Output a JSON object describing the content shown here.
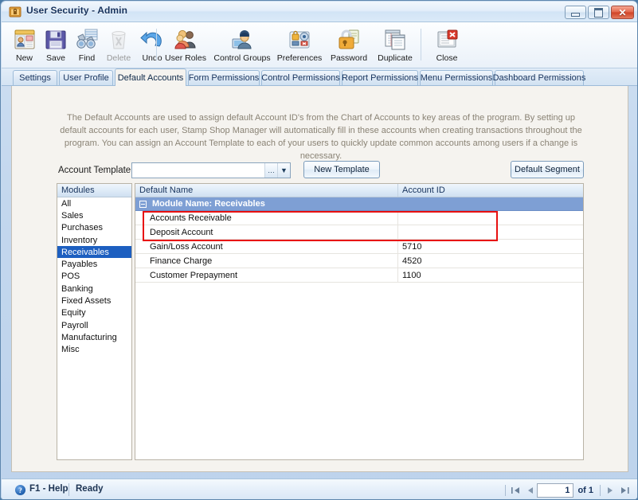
{
  "window": {
    "title": "User Security - Admin",
    "icon": "security-shield-icon",
    "minimize_label": "–",
    "maximize_label": "□",
    "close_label": "✕"
  },
  "toolbar": {
    "buttons": [
      {
        "label": "New",
        "icon": "new-record-icon",
        "enabled": true
      },
      {
        "label": "Save",
        "icon": "floppy-disk-icon",
        "enabled": true
      },
      {
        "label": "Find",
        "icon": "binoculars-icon",
        "enabled": true
      },
      {
        "label": "Delete",
        "icon": "recycle-bin-icon",
        "enabled": false
      },
      {
        "label": "Undo",
        "icon": "undo-arrow-icon",
        "enabled": true
      },
      {
        "label": "User Roles",
        "icon": "users-group-icon",
        "enabled": true
      },
      {
        "label": "Control Groups",
        "icon": "user-monitor-icon",
        "enabled": true
      },
      {
        "label": "Preferences",
        "icon": "lock-settings-icon",
        "enabled": true
      },
      {
        "label": "Password",
        "icon": "padlock-key-icon",
        "enabled": true
      },
      {
        "label": "Duplicate",
        "icon": "copy-window-icon",
        "enabled": true
      },
      {
        "label": "Close",
        "icon": "close-window-icon",
        "enabled": true
      }
    ]
  },
  "tabs": [
    {
      "label": "Settings",
      "active": false
    },
    {
      "label": "User Profile",
      "active": false
    },
    {
      "label": "Default Accounts",
      "active": true
    },
    {
      "label": "Form Permissions",
      "active": false
    },
    {
      "label": "Control Permissions",
      "active": false
    },
    {
      "label": "Report Permissions",
      "active": false
    },
    {
      "label": "Menu Permissions",
      "active": false
    },
    {
      "label": "Dashboard Permissions",
      "active": false
    }
  ],
  "content": {
    "description": "The Default Accounts are used to assign default Account ID's from the Chart of Accounts to key areas of the program.  By setting up default accounts for each user, Stamp Shop Manager will automatically fill in these accounts when creating transactions throughout the program.  You can assign an Account Template to each of your users to quickly update common accounts among users if a change is necessary.",
    "account_template_label": "Account Template",
    "account_template_value": "",
    "account_template_placeholder": "",
    "ellipsis_button": "…",
    "dropdown_button": "▼",
    "new_template_button": "New Template",
    "default_segment_button": "Default Segment"
  },
  "modules": {
    "header": "Modules",
    "items": [
      {
        "label": "All",
        "selected": false
      },
      {
        "label": "Sales",
        "selected": false
      },
      {
        "label": "Purchases",
        "selected": false
      },
      {
        "label": "Inventory",
        "selected": false
      },
      {
        "label": "Receivables",
        "selected": true
      },
      {
        "label": "Payables",
        "selected": false
      },
      {
        "label": "POS",
        "selected": false
      },
      {
        "label": "Banking",
        "selected": false
      },
      {
        "label": "Fixed Assets",
        "selected": false
      },
      {
        "label": "Equity",
        "selected": false
      },
      {
        "label": "Payroll",
        "selected": false
      },
      {
        "label": "Manufacturing",
        "selected": false
      },
      {
        "label": "Misc",
        "selected": false
      }
    ]
  },
  "grid": {
    "columns": [
      "Default Name",
      "Account ID"
    ],
    "group_row": "Module Name: Receivables",
    "rows": [
      {
        "name": "Accounts Receivable",
        "id": ""
      },
      {
        "name": "Deposit Account",
        "id": ""
      },
      {
        "name": "Gain/Loss Account",
        "id": "5710"
      },
      {
        "name": "Finance Charge",
        "id": "4520"
      },
      {
        "name": "Customer Prepayment",
        "id": "1100"
      }
    ],
    "highlight_color": "#e81010"
  },
  "statusbar": {
    "help_icon": "help-question-icon",
    "help_label": "F1 - Help",
    "status_text": "Ready",
    "pager": {
      "first": "⏮",
      "prev": "◀",
      "page_value": "1",
      "of_label": "of 1",
      "next": "▶",
      "last": "⏭"
    }
  }
}
